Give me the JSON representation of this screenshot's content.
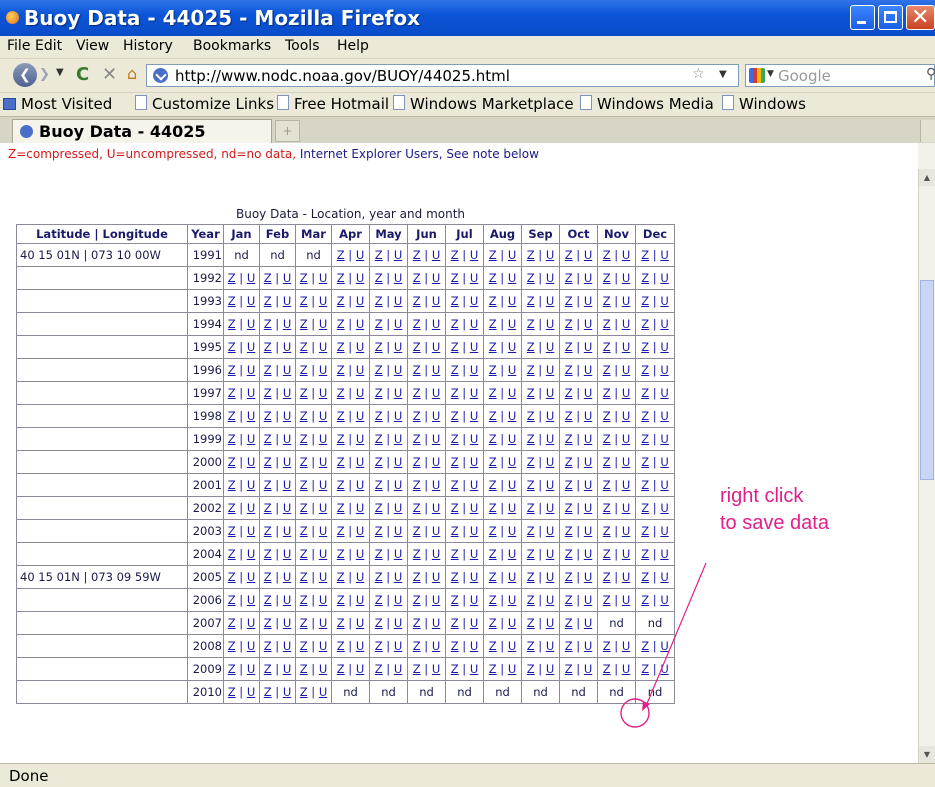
{
  "window": {
    "title": "Buoy Data - 44025 - Mozilla Firefox"
  },
  "menu": [
    "File",
    "Edit",
    "View",
    "History",
    "Bookmarks",
    "Tools",
    "Help"
  ],
  "nav": {
    "url": "http://www.nodc.noaa.gov/BUOY/44025.html",
    "search_placeholder": "Google"
  },
  "bookmarks": [
    "Most Visited",
    "Customize Links",
    "Free Hotmail",
    "Windows Marketplace",
    "Windows Media",
    "Windows"
  ],
  "tab": {
    "label": "Buoy Data - 44025"
  },
  "note": {
    "text": "Z=compressed, U=uncompressed, nd=no data, ",
    "link": "Internet Explorer Users, See note below"
  },
  "table": {
    "caption": "Buoy Data - Location, year and month",
    "headers": [
      "Latitude | Longitude",
      "Year",
      "Jan",
      "Feb",
      "Mar",
      "Apr",
      "May",
      "Jun",
      "Jul",
      "Aug",
      "Sep",
      "Oct",
      "Nov",
      "Dec"
    ],
    "link_z": "Z",
    "link_u": "U",
    "separator": "|",
    "nd": "nd",
    "rows": [
      {
        "loc": "40 15 01N | 073 10 00W",
        "year": "1991",
        "cells": [
          "nd",
          "nd",
          "nd",
          "zu",
          "zu",
          "zu",
          "zu",
          "zu",
          "zu",
          "zu",
          "zu",
          "zu"
        ]
      },
      {
        "loc": "",
        "year": "1992",
        "cells": [
          "zu",
          "zu",
          "zu",
          "zu",
          "zu",
          "zu",
          "zu",
          "zu",
          "zu",
          "zu",
          "zu",
          "zu"
        ]
      },
      {
        "loc": "",
        "year": "1993",
        "cells": [
          "zu",
          "zu",
          "zu",
          "zu",
          "zu",
          "zu",
          "zu",
          "zu",
          "zu",
          "zu",
          "zu",
          "zu"
        ]
      },
      {
        "loc": "",
        "year": "1994",
        "cells": [
          "zu",
          "zu",
          "zu",
          "zu",
          "zu",
          "zu",
          "zu",
          "zu",
          "zu",
          "zu",
          "zu",
          "zu"
        ]
      },
      {
        "loc": "",
        "year": "1995",
        "cells": [
          "zu",
          "zu",
          "zu",
          "zu",
          "zu",
          "zu",
          "zu",
          "zu",
          "zu",
          "zu",
          "zu",
          "zu"
        ]
      },
      {
        "loc": "",
        "year": "1996",
        "cells": [
          "zu",
          "zu",
          "zu",
          "zu",
          "zu",
          "zu",
          "zu",
          "zu",
          "zu",
          "zu",
          "zu",
          "zu"
        ]
      },
      {
        "loc": "",
        "year": "1997",
        "cells": [
          "zu",
          "zu",
          "zu",
          "zu",
          "zu",
          "zu",
          "zu",
          "zu",
          "zu",
          "zu",
          "zu",
          "zu"
        ]
      },
      {
        "loc": "",
        "year": "1998",
        "cells": [
          "zu",
          "zu",
          "zu",
          "zu",
          "zu",
          "zu",
          "zu",
          "zu",
          "zu",
          "zu",
          "zu",
          "zu"
        ]
      },
      {
        "loc": "",
        "year": "1999",
        "cells": [
          "zu",
          "zu",
          "zu",
          "zu",
          "zu",
          "zu",
          "zu",
          "zu",
          "zu",
          "zu",
          "zu",
          "zu"
        ]
      },
      {
        "loc": "",
        "year": "2000",
        "cells": [
          "zu",
          "zu",
          "zu",
          "zu",
          "zu",
          "zu",
          "zu",
          "zu",
          "zu",
          "zu",
          "zu",
          "zu"
        ]
      },
      {
        "loc": "",
        "year": "2001",
        "cells": [
          "zu",
          "zu",
          "zu",
          "zu",
          "zu",
          "zu",
          "zu",
          "zu",
          "zu",
          "zu",
          "zu",
          "zu"
        ]
      },
      {
        "loc": "",
        "year": "2002",
        "cells": [
          "zu",
          "zu",
          "zu",
          "zu",
          "zu",
          "zu",
          "zu",
          "zu",
          "zu",
          "zu",
          "zu",
          "zu"
        ]
      },
      {
        "loc": "",
        "year": "2003",
        "cells": [
          "zu",
          "zu",
          "zu",
          "zu",
          "zu",
          "zu",
          "zu",
          "zu",
          "zu",
          "zu",
          "zu",
          "zu"
        ]
      },
      {
        "loc": "",
        "year": "2004",
        "cells": [
          "zu",
          "zu",
          "zu",
          "zu",
          "zu",
          "zu",
          "zu",
          "zu",
          "zu",
          "zu",
          "zu",
          "zu"
        ]
      },
      {
        "loc": "40 15 01N | 073 09 59W",
        "year": "2005",
        "cells": [
          "zu",
          "zu",
          "zu",
          "zu",
          "zu",
          "zu",
          "zu",
          "zu",
          "zu",
          "zu",
          "zu",
          "zu"
        ]
      },
      {
        "loc": "",
        "year": "2006",
        "cells": [
          "zu",
          "zu",
          "zu",
          "zu",
          "zu",
          "zu",
          "zu",
          "zu",
          "zu",
          "zu",
          "zu",
          "zu"
        ]
      },
      {
        "loc": "",
        "year": "2007",
        "cells": [
          "zu",
          "zu",
          "zu",
          "zu",
          "zu",
          "zu",
          "zu",
          "zu",
          "zu",
          "zu",
          "nd",
          "nd"
        ]
      },
      {
        "loc": "",
        "year": "2008",
        "cells": [
          "zu",
          "zu",
          "zu",
          "zu",
          "zu",
          "zu",
          "zu",
          "zu",
          "zu",
          "zu",
          "zu",
          "zu"
        ]
      },
      {
        "loc": "",
        "year": "2009",
        "cells": [
          "zu",
          "zu",
          "zu",
          "zu",
          "zu",
          "zu",
          "zu",
          "zu",
          "zu",
          "zu",
          "zu",
          "zu"
        ]
      },
      {
        "loc": "",
        "year": "2010",
        "cells": [
          "zu",
          "zu",
          "zu",
          "nd",
          "nd",
          "nd",
          "nd",
          "nd",
          "nd",
          "nd",
          "nd",
          "nd"
        ]
      }
    ]
  },
  "annotation": {
    "line1": "right click",
    "line2": "to save data",
    "color": "#e0208a"
  },
  "status": {
    "text": "Done"
  }
}
